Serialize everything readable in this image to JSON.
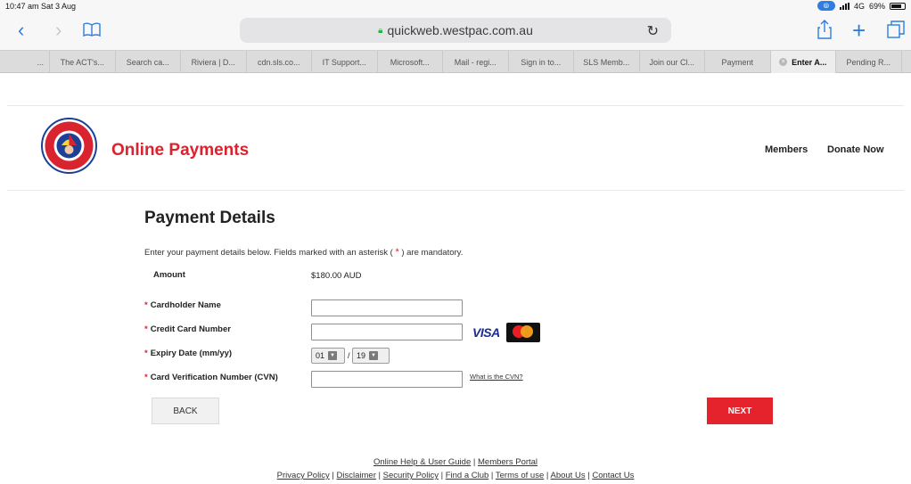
{
  "status_bar": {
    "time_date": "10:47 am  Sat 3 Aug",
    "network": "4G",
    "battery": "69%"
  },
  "browser": {
    "url": "quickweb.westpac.com.au"
  },
  "tabs": [
    {
      "label": "...",
      "active": false
    },
    {
      "label": "The ACT's...",
      "active": false
    },
    {
      "label": "Search ca...",
      "active": false
    },
    {
      "label": "Riviera | D...",
      "active": false
    },
    {
      "label": "cdn.sls.co...",
      "active": false
    },
    {
      "label": "IT Support...",
      "active": false
    },
    {
      "label": "Microsoft...",
      "active": false
    },
    {
      "label": "Mail - regi...",
      "active": false
    },
    {
      "label": "Sign in to...",
      "active": false
    },
    {
      "label": "SLS Memb...",
      "active": false
    },
    {
      "label": "Join our Cl...",
      "active": false
    },
    {
      "label": "Payment",
      "active": false
    },
    {
      "label": "Enter A...",
      "active": true
    },
    {
      "label": "Pending R...",
      "active": false
    }
  ],
  "header": {
    "logo_text": "SURF LIFE SAVING",
    "title": "Online Payments",
    "nav": {
      "members": "Members",
      "donate": "Donate Now"
    }
  },
  "form": {
    "heading": "Payment Details",
    "intro_before": "Enter your payment details below. Fields marked with an asterisk ( ",
    "intro_star": "*",
    "intro_after": " ) are mandatory.",
    "amount_label": "Amount",
    "amount_value": "$180.00 AUD",
    "required_marker": "*",
    "fields": {
      "cardholder_name": {
        "label": "Cardholder Name",
        "value": ""
      },
      "card_number": {
        "label": "Credit Card Number",
        "value": ""
      },
      "expiry": {
        "label": "Expiry Date (mm/yy)",
        "month": "01",
        "year": "19",
        "separator": "/"
      },
      "cvn": {
        "label": "Card Verification Number (CVN)",
        "value": "",
        "help_link": "What is the CVN?"
      }
    },
    "card_logos": {
      "visa": "VISA"
    },
    "back_label": "BACK",
    "next_label": "NEXT"
  },
  "footer": {
    "line1": [
      "Online Help & User Guide",
      "Members Portal"
    ],
    "line2": [
      "Privacy Policy",
      "Disclaimer",
      "Security Policy",
      "Find a Club",
      "Terms of use",
      "About Us",
      "Contact Us"
    ]
  },
  "colors": {
    "brand_red": "#d9232e",
    "ios_blue": "#2f7de1"
  }
}
